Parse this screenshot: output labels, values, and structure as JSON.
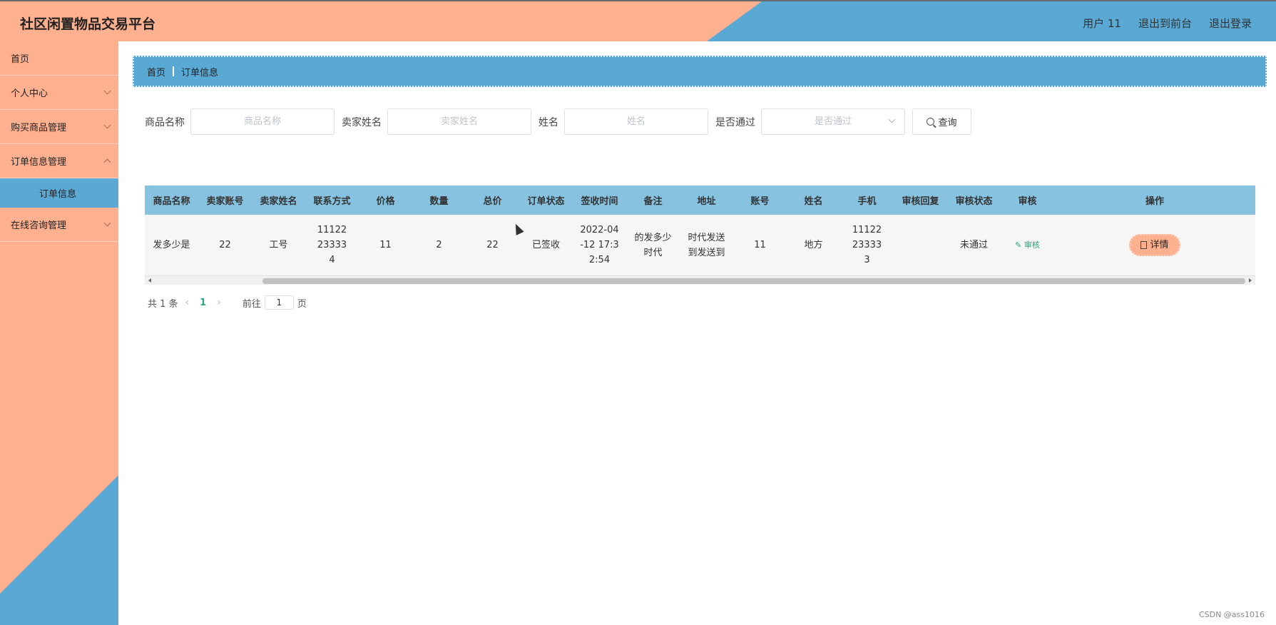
{
  "app": {
    "title": "社区闲置物品交易平台"
  },
  "header": {
    "user": "用户 11",
    "to_front": "退出到前台",
    "logout": "退出登录"
  },
  "sidebar": {
    "items": [
      {
        "label": "首页"
      },
      {
        "label": "个人中心"
      },
      {
        "label": "购买商品管理"
      },
      {
        "label": "订单信息管理"
      },
      {
        "label": "在线咨询管理"
      }
    ],
    "sub_active": "订单信息"
  },
  "breadcrumb": {
    "home": "首页",
    "current": "订单信息"
  },
  "search": {
    "product_name_label": "商品名称",
    "product_name_placeholder": "商品名称",
    "seller_name_label": "卖家姓名",
    "seller_name_placeholder": "卖家姓名",
    "name_label": "姓名",
    "name_placeholder": "姓名",
    "approved_label": "是否通过",
    "approved_placeholder": "是否通过",
    "query_button": "查询"
  },
  "table": {
    "headers": [
      "商品名称",
      "卖家账号",
      "卖家姓名",
      "联系方式",
      "价格",
      "数量",
      "总价",
      "订单状态",
      "签收时间",
      "备注",
      "地址",
      "账号",
      "姓名",
      "手机",
      "审核回复",
      "审核状态",
      "审核",
      "操作"
    ],
    "rows": [
      {
        "product_name": "发多少是",
        "seller_account": "22",
        "seller_name": "工号",
        "contact": "11122233334",
        "price": "11",
        "quantity": "2",
        "total": "22",
        "order_status": "已签收",
        "sign_time": "2022-04-12 17:32:54",
        "remark": "的发多少时代",
        "address": "时代发送到发送到",
        "account": "11",
        "name": "地方",
        "phone": "11122233333",
        "audit_reply": "",
        "audit_status": "未通过",
        "audit_action": "审核",
        "detail_action": "详情"
      }
    ]
  },
  "pagination": {
    "total": "共 1 条",
    "current": "1",
    "goto_label": "前往",
    "goto_value": "1",
    "page_unit": "页"
  },
  "watermark": "CSDN @ass1016"
}
